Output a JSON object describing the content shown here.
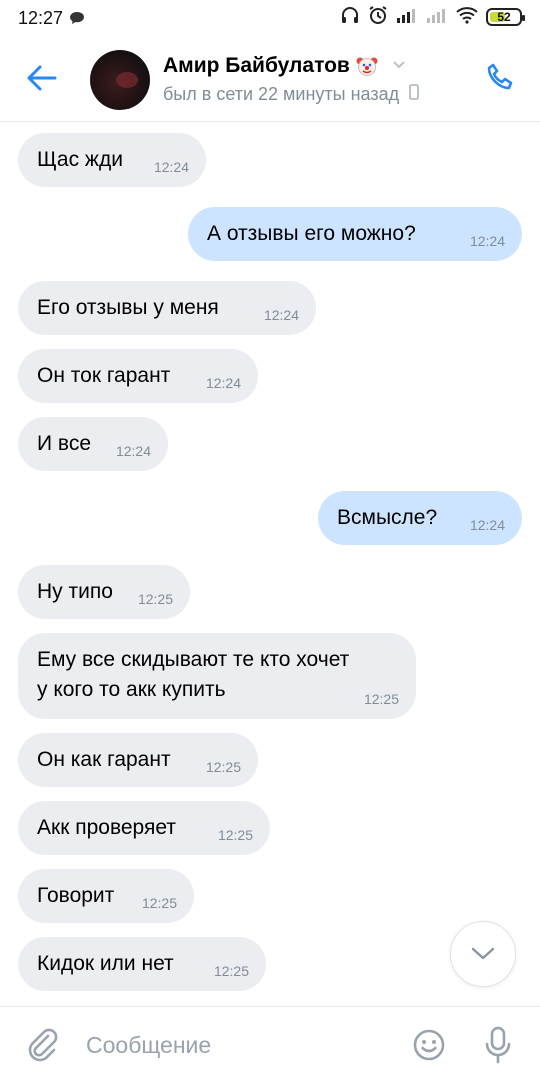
{
  "status_bar": {
    "time": "12:27",
    "battery_level": "52",
    "icons": [
      "chat-bubble-icon",
      "headphones-icon",
      "alarm-icon",
      "signal-icon",
      "signal-weak-icon",
      "wifi-icon",
      "battery-icon"
    ]
  },
  "header": {
    "contact_name": "Амир Байбулатов",
    "contact_emoji": "clown-face-icon",
    "last_seen": "был в сети 22 минуты назад",
    "accent_color": "#2787f5"
  },
  "messages": [
    {
      "dir": "in",
      "text": "Щас жди",
      "time": "12:24"
    },
    {
      "dir": "out",
      "text": "А отзывы его можно?",
      "time": "12:24"
    },
    {
      "dir": "in",
      "text": "Его отзывы у меня",
      "time": "12:24"
    },
    {
      "dir": "in",
      "text": "Он ток гарант",
      "time": "12:24"
    },
    {
      "dir": "in",
      "text": "И все",
      "time": "12:24"
    },
    {
      "dir": "out",
      "text": "Всмысле?",
      "time": "12:24"
    },
    {
      "dir": "in",
      "text": "Ну типо",
      "time": "12:25"
    },
    {
      "dir": "in",
      "text": "Ему все скидывают те кто хочет\nу кого то акк купить",
      "time": "12:25"
    },
    {
      "dir": "in",
      "text": "Он как гарант",
      "time": "12:25"
    },
    {
      "dir": "in",
      "text": "Акк проверяет",
      "time": "12:25"
    },
    {
      "dir": "in",
      "text": "Говорит",
      "time": "12:25"
    },
    {
      "dir": "in",
      "text": "Кидок или нет",
      "time": "12:25"
    }
  ],
  "composer": {
    "placeholder": "Сообщение",
    "value": ""
  },
  "colors": {
    "incoming_bubble": "#ebedf0",
    "outgoing_bubble": "#cce4ff",
    "secondary_text": "#818c99"
  }
}
